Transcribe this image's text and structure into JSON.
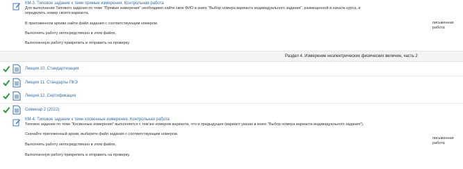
{
  "assignment1": {
    "title": "КМ-3. Типовое задание к теме прямые измерения. Контрольная работа",
    "lines": [
      "Для выполнения Типового задания по теме \"Прямые измерения\" необходимо найти свои ФИО в книге \"Выбор номера варианта индивидуального задания\", размещенной в начале курса, и",
      "определить номер своего варианта.",
      "В приложенном архиве найти файл задания с соответствующим номером.",
      "Выполнять работу непосредственно в этом файле.",
      "Выполненную работу прикрепить и отправить на проверку."
    ],
    "type_label": "письменная работа"
  },
  "section": {
    "title": "Раздел 4. Измерение неэлектрических физических величин, часть 2"
  },
  "resources": [
    {
      "label": "Лекция 10. Стандартизация"
    },
    {
      "label": "Лекция 11. Стандарты ПКЭ"
    },
    {
      "label": "Лекция 12. Сертификация"
    },
    {
      "label": "Семинар 2 (2022)"
    }
  ],
  "assignment2": {
    "title": "КМ-4. Типовое задание к теме косвенные измерения. Контрольная работа",
    "lines": [
      "Типовое задание по теме \"Косвенные измерения\" выполняется с тем же номером варианта, что и предыдущее (вариант указан в книге \"Выбор номера варианта индивидуального задания\").",
      "Скачайте приложенный архив, выберите файл задания с соответствующим номером.",
      "Выполнять работу непосредственно в этом файле.",
      "Выполненную работу прикрепить и отправить на проверку."
    ],
    "type_label": "письменная работа"
  },
  "colors": {
    "link": "#3a6ea5",
    "check": "#2e9a3e",
    "doc_icon": "#3b6fb0",
    "assign_icon": "#3b78c9"
  }
}
